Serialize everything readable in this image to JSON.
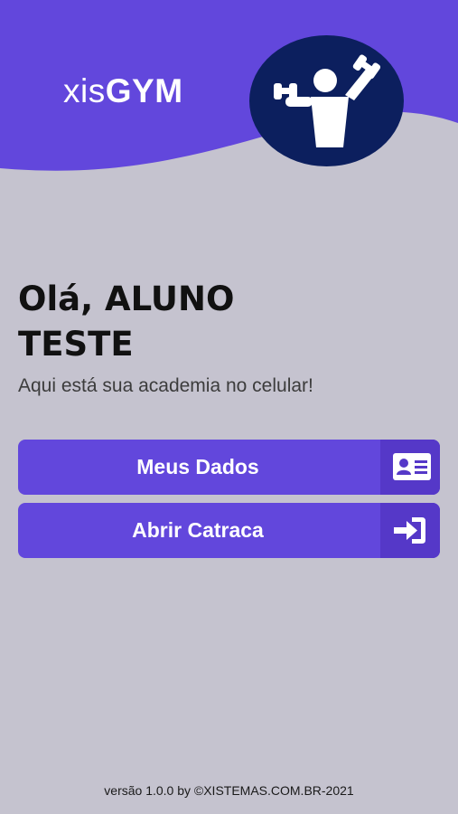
{
  "colors": {
    "header": "#6247dc",
    "background": "#c5c3cf",
    "avatar_bg": "#0c1f5e",
    "button": "#6247dc"
  },
  "header": {
    "logo_light": "xis",
    "logo_bold": "GYM",
    "avatar_icon": "weightlifter-icon"
  },
  "main": {
    "greeting": "Olá, ALUNO TESTE",
    "subtitle": "Aqui está sua academia no celular!"
  },
  "buttons": [
    {
      "label": "Meus Dados",
      "icon": "id-card-icon"
    },
    {
      "label": "Abrir Catraca",
      "icon": "sign-in-icon"
    }
  ],
  "footer": {
    "text": "versão 1.0.0 by ©XISTEMAS.COM.BR-2021"
  }
}
